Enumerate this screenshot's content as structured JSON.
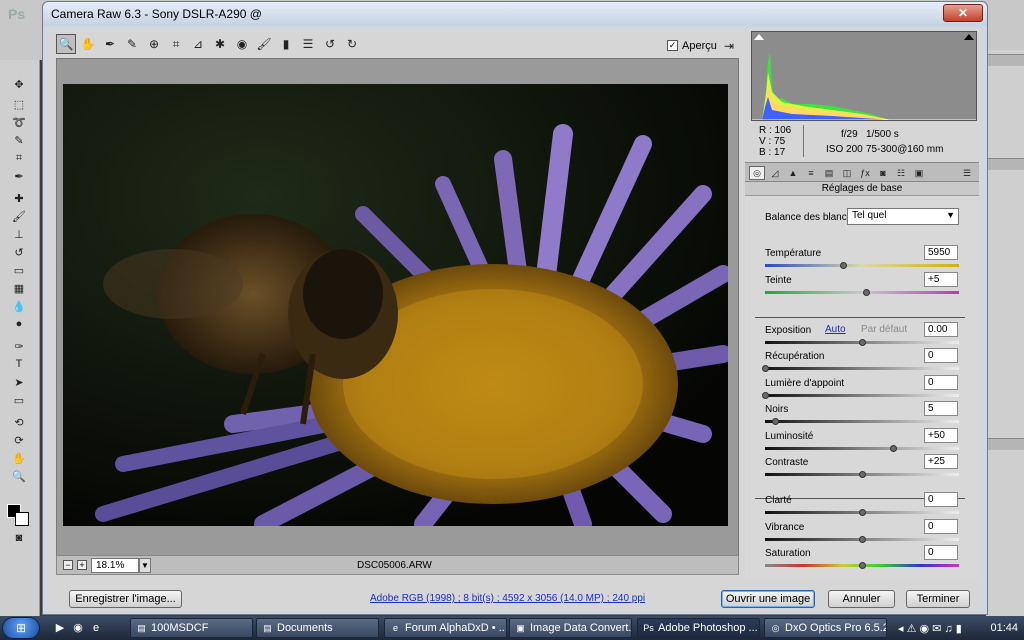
{
  "photoshop": {
    "logo": "Ps"
  },
  "window": {
    "title": "Camera Raw 6.3  -  Sony DSLR-A290 @"
  },
  "toolbar": {
    "tools": [
      "zoom-icon",
      "hand-icon",
      "white-balance-icon",
      "color-sampler-icon",
      "targeted-adjust-icon",
      "crop-icon",
      "straighten-icon",
      "spot-removal-icon",
      "red-eye-icon",
      "adjustment-brush-icon",
      "graduated-filter-icon",
      "preferences-icon",
      "rotate-left-icon",
      "rotate-right-icon"
    ],
    "preview_label": "Aperçu",
    "preview_checked": true
  },
  "preview": {
    "zoom": "18.1%",
    "filename": "DSC05006.ARW"
  },
  "histogram": {
    "colors": [
      "#ff4040",
      "#40ff40",
      "#4060ff",
      "#ffff40",
      "#ff40ff",
      "#40ffff"
    ]
  },
  "info": {
    "r": "R :  106",
    "v": "V :   75",
    "b": "B :   17",
    "aperture": "f/29",
    "shutter": "1/500 s",
    "iso": "ISO 200",
    "lens": "75-300@160 mm"
  },
  "panel": {
    "title": "Réglages de base",
    "tabs": [
      "basic",
      "tone-curve",
      "detail",
      "hsl",
      "split-toning",
      "lens-corrections",
      "effects",
      "camera-calibration",
      "presets",
      "snapshots"
    ],
    "wb_label": "Balance des blancs :",
    "wb_value": "Tel quel",
    "auto_label": "Auto",
    "default_label": "Par défaut",
    "sliders": [
      {
        "label": "Température",
        "value": "5950",
        "pos": 0.4
      },
      {
        "label": "Teinte",
        "value": "+5",
        "pos": 0.52
      },
      {
        "label": "Exposition",
        "value": "0.00",
        "pos": 0.5
      },
      {
        "label": "Récupération",
        "value": "0",
        "pos": 0.0
      },
      {
        "label": "Lumière d'appoint",
        "value": "0",
        "pos": 0.0
      },
      {
        "label": "Noirs",
        "value": "5",
        "pos": 0.05
      },
      {
        "label": "Luminosité",
        "value": "+50",
        "pos": 0.66
      },
      {
        "label": "Contraste",
        "value": "+25",
        "pos": 0.5
      },
      {
        "label": "Clarté",
        "value": "0",
        "pos": 0.5
      },
      {
        "label": "Vibrance",
        "value": "0",
        "pos": 0.5
      },
      {
        "label": "Saturation",
        "value": "0",
        "pos": 0.5
      }
    ]
  },
  "footer": {
    "save": "Enregistrer l'image...",
    "workflow": "Adobe RGB (1998) ; 8 bit(s) ; 4592 x 3056 (14.0 MP) ; 240 ppi",
    "open": "Ouvrir une image",
    "cancel": "Annuler",
    "done": "Terminer"
  },
  "taskbar": {
    "items": [
      {
        "label": "100MSDCF",
        "icon": "folder-icon"
      },
      {
        "label": "Documents",
        "icon": "folder-icon"
      },
      {
        "label": "Forum AlphaDxD • ...",
        "icon": "ie-icon"
      },
      {
        "label": "Image Data Convert...",
        "icon": "app-icon"
      },
      {
        "label": "Adobe Photoshop ...",
        "icon": "photoshop-icon"
      },
      {
        "label": "DxO Optics Pro 6.5.2...",
        "icon": "dxo-icon"
      }
    ],
    "clock": "01:44"
  }
}
